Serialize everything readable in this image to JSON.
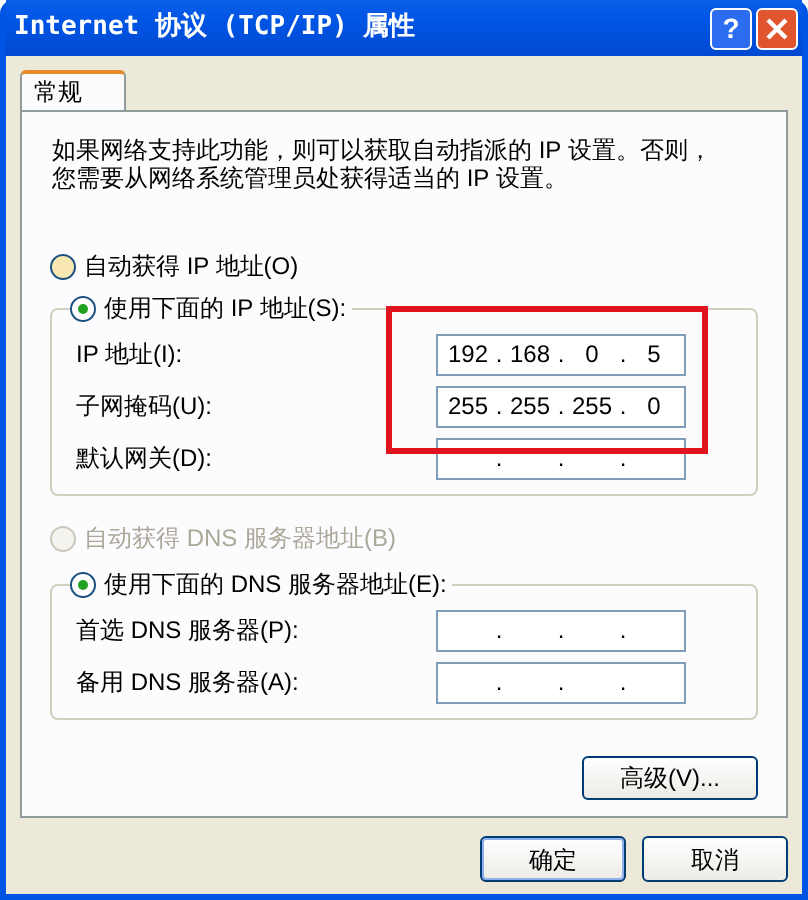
{
  "window": {
    "title": "Internet 协议 (TCP/IP) 属性",
    "title_buttons": [
      {
        "kind": "help",
        "label": "?"
      },
      {
        "kind": "close"
      }
    ]
  },
  "tabs": [
    {
      "label": "常规",
      "selected": true
    }
  ],
  "description": "如果网络支持此功能，则可以获取自动指派的 IP 设置。否则，您需要从网络系统管理员处获得适当的 IP 设置。",
  "ip_mode": [
    {
      "label": "自动获得 IP 地址(O)",
      "selected": false,
      "disabled": false
    },
    {
      "label": "使用下面的 IP 地址(S):",
      "selected": true,
      "disabled": false
    }
  ],
  "ip_fields": [
    {
      "label": "IP 地址(I):",
      "octets": [
        "192",
        "168",
        "0",
        "5"
      ],
      "separators": [
        ".",
        ".",
        "."
      ]
    },
    {
      "label": "子网掩码(U):",
      "octets": [
        "255",
        "255",
        "255",
        "0"
      ],
      "separators": [
        ".",
        ".",
        "."
      ]
    },
    {
      "label": "默认网关(D):",
      "separators": [
        ".",
        ".",
        "."
      ]
    }
  ],
  "dns_mode": [
    {
      "label": "自动获得 DNS 服务器地址(B)",
      "selected": false,
      "disabled": true
    },
    {
      "label": "使用下面的 DNS 服务器地址(E):",
      "selected": true,
      "disabled": false
    }
  ],
  "dns_fields": [
    {
      "label": "首选 DNS 服务器(P):",
      "separators": [
        ".",
        ".",
        "."
      ]
    },
    {
      "label": "备用 DNS 服务器(A):",
      "separators": [
        ".",
        ".",
        "."
      ]
    }
  ],
  "advanced_button": "高级(V)...",
  "buttons": [
    "确定",
    "取消"
  ],
  "annotations": [
    {
      "kind": "box"
    }
  ]
}
